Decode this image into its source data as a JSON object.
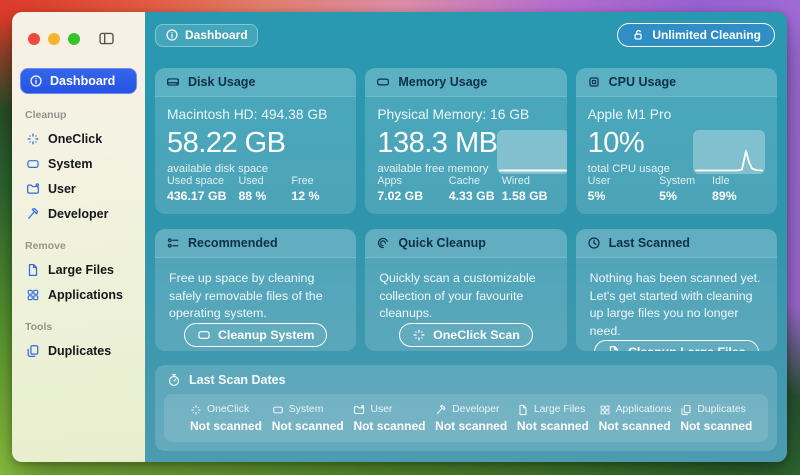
{
  "header": {
    "title": "Dashboard",
    "action_label": "Unlimited Cleaning"
  },
  "sidebar": {
    "dashboard": {
      "label": "Dashboard"
    },
    "sections": [
      {
        "label": "Cleanup",
        "items": [
          {
            "label": "OneClick"
          },
          {
            "label": "System"
          },
          {
            "label": "User"
          },
          {
            "label": "Developer"
          }
        ]
      },
      {
        "label": "Remove",
        "items": [
          {
            "label": "Large Files"
          },
          {
            "label": "Applications"
          }
        ]
      },
      {
        "label": "Tools",
        "items": [
          {
            "label": "Duplicates"
          }
        ]
      }
    ]
  },
  "cards": {
    "disk": {
      "title": "Disk Usage",
      "subtitle": "Macintosh HD: 494.38 GB",
      "big": "58.22 GB",
      "caption": "available disk space",
      "stats": [
        {
          "label": "Used space",
          "value": "436.17 GB"
        },
        {
          "label": "Used",
          "value": "88 %"
        },
        {
          "label": "Free",
          "value": "12 %"
        }
      ]
    },
    "memory": {
      "title": "Memory Usage",
      "subtitle": "Physical Memory: 16 GB",
      "big": "138.3 MB",
      "caption": "available free memory",
      "stats": [
        {
          "label": "Apps",
          "value": "7.02 GB"
        },
        {
          "label": "Cache",
          "value": "4.33 GB"
        },
        {
          "label": "Wired",
          "value": "1.58 GB"
        }
      ]
    },
    "cpu": {
      "title": "CPU Usage",
      "subtitle": "Apple M1 Pro",
      "big": "10%",
      "caption": "total CPU usage",
      "stats": [
        {
          "label": "User",
          "value": "5%"
        },
        {
          "label": "System",
          "value": "5%"
        },
        {
          "label": "Idle",
          "value": "89%"
        }
      ]
    },
    "recommended": {
      "title": "Recommended",
      "text": "Free up space by cleaning safely removable files of the operating system.",
      "button": "Cleanup System"
    },
    "quick": {
      "title": "Quick Cleanup",
      "text": "Quickly scan a customizable collection of your favourite cleanups.",
      "button": "OneClick Scan"
    },
    "last_scanned": {
      "title": "Last Scanned",
      "text": "Nothing has been scanned yet. Let's get started with cleaning up large files you no longer need.",
      "button": "Cleanup Large Files"
    }
  },
  "scan": {
    "title": "Last Scan Dates",
    "items": [
      {
        "label": "OneClick",
        "status": "Not scanned"
      },
      {
        "label": "System",
        "status": "Not scanned"
      },
      {
        "label": "User",
        "status": "Not scanned"
      },
      {
        "label": "Developer",
        "status": "Not scanned"
      },
      {
        "label": "Large Files",
        "status": "Not scanned"
      },
      {
        "label": "Applications",
        "status": "Not scanned"
      },
      {
        "label": "Duplicates",
        "status": "Not scanned"
      }
    ]
  },
  "colors": {
    "accent_blue": "#2b5ce2",
    "content_teal": "#2e95ac",
    "sidebar_cream": "#f2f1de",
    "title_navy": "#103049",
    "upsell_blue": "#3485d6",
    "traffic_red": "#f2493f",
    "traffic_yellow": "#f6b32d",
    "traffic_green": "#35c32d"
  }
}
